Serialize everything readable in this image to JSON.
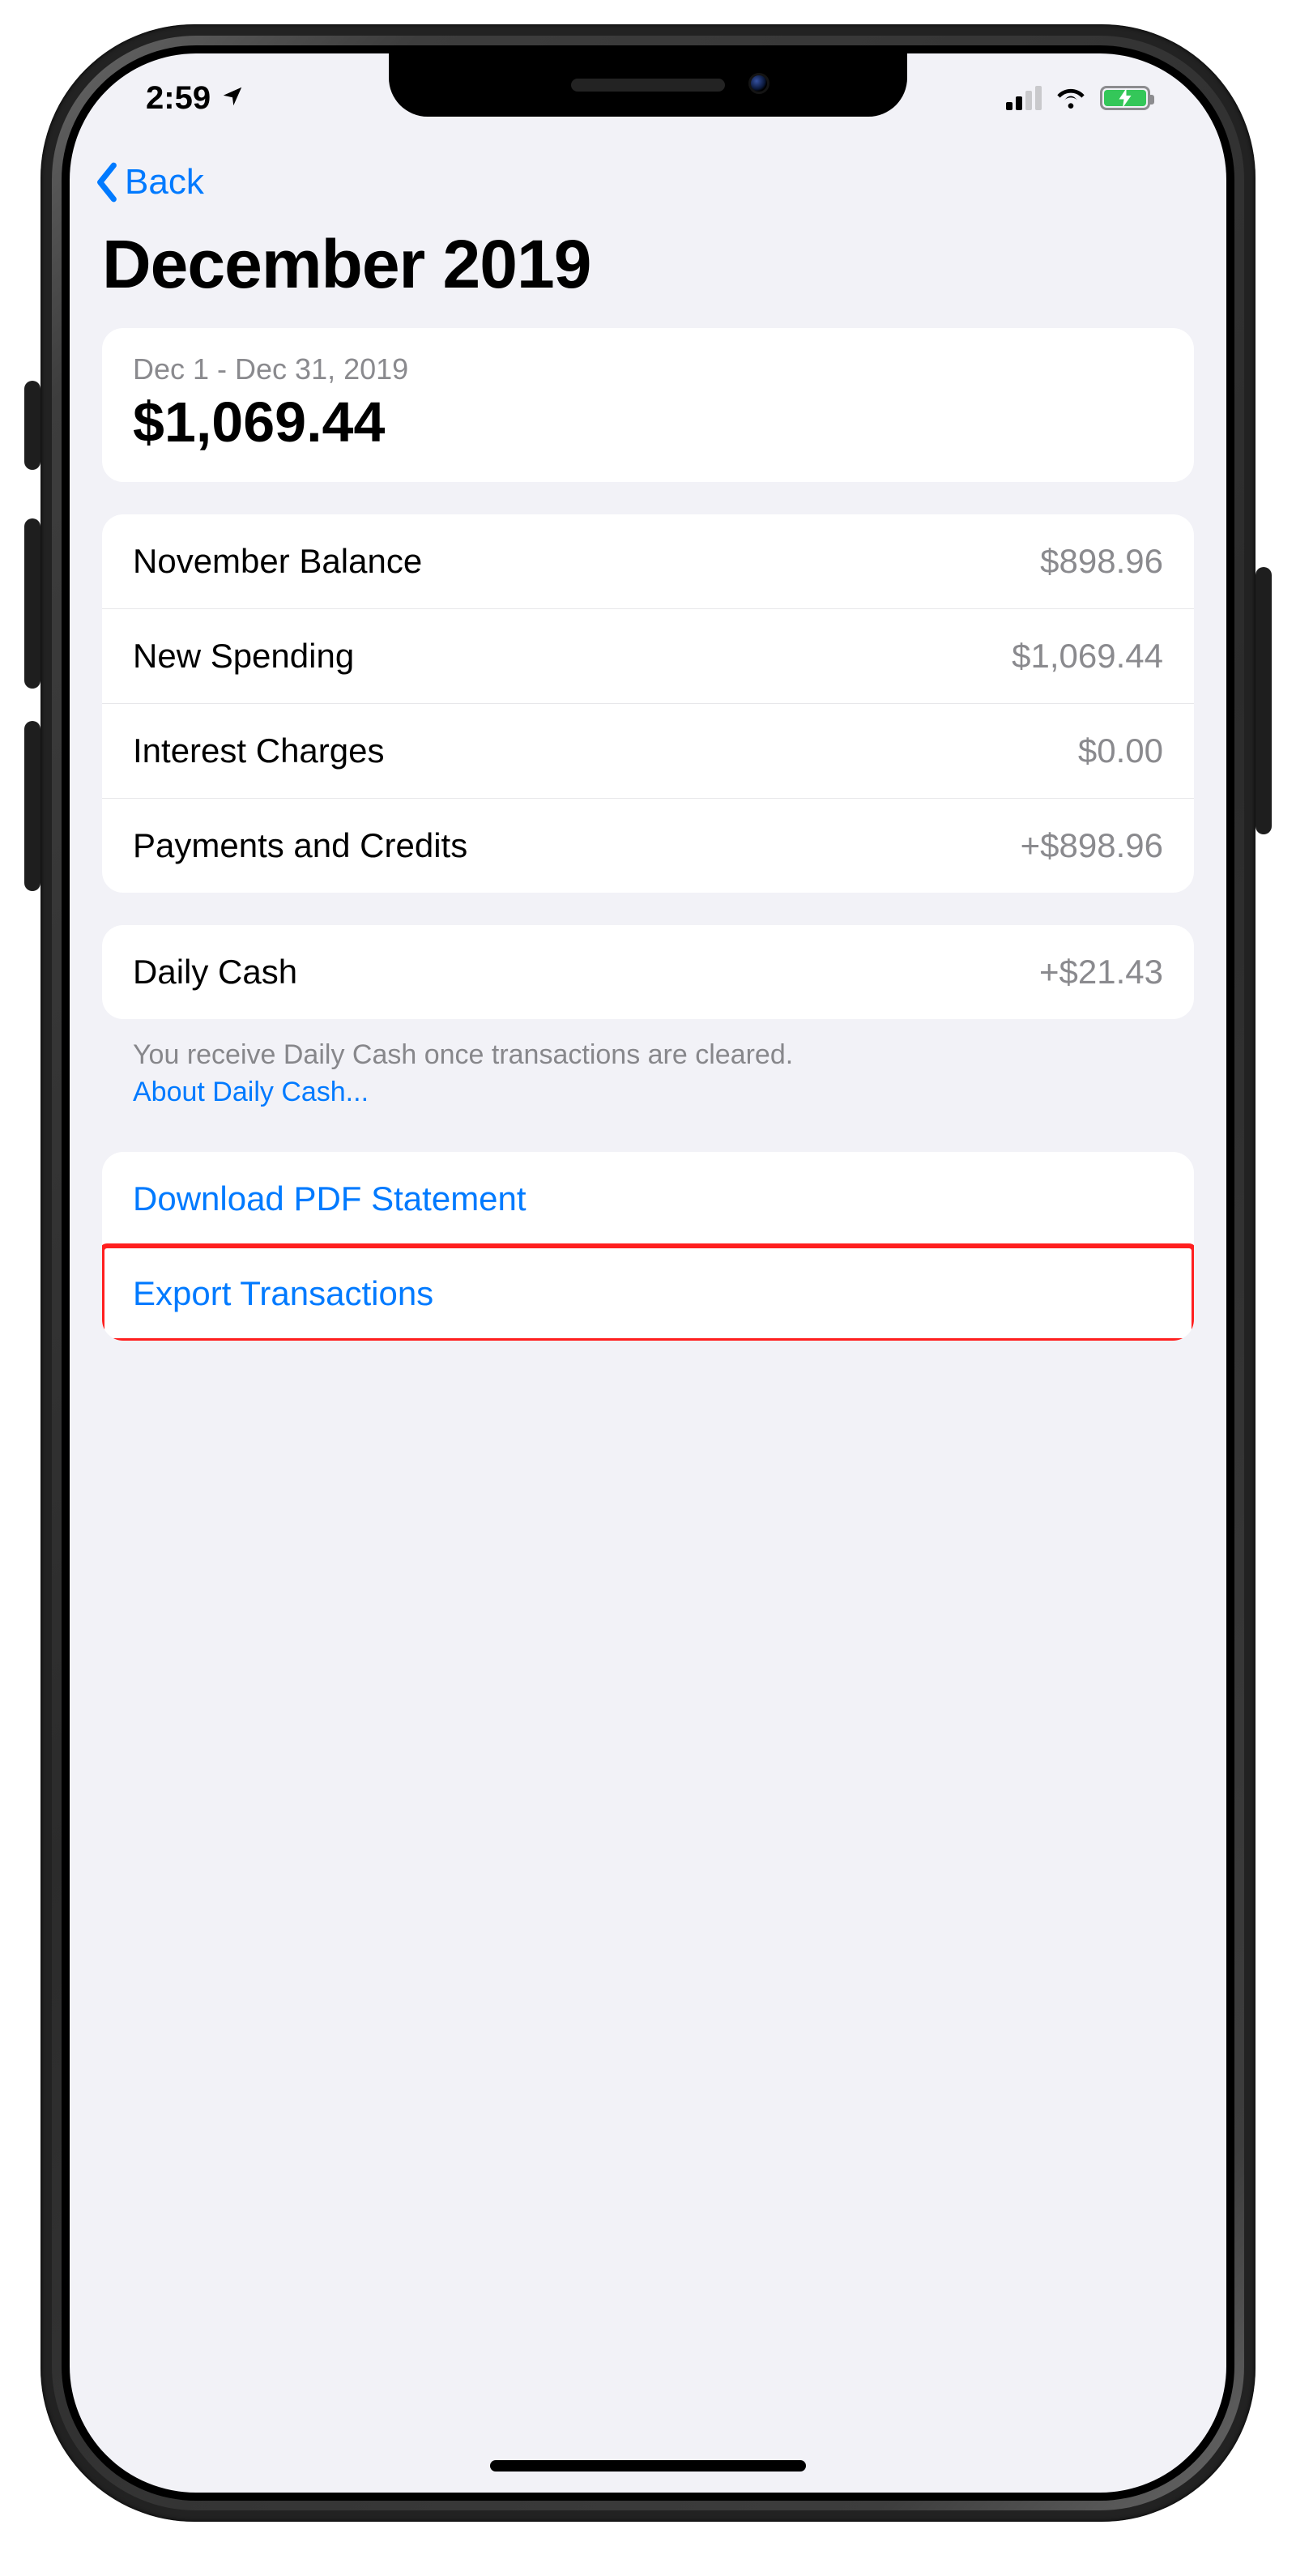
{
  "status": {
    "time": "2:59",
    "location_services": true,
    "signal_bars_active": 2,
    "wifi": true,
    "battery_charging": true
  },
  "nav": {
    "back_label": "Back"
  },
  "title": "December 2019",
  "summary": {
    "range": "Dec 1 - Dec 31, 2019",
    "amount": "$1,069.44"
  },
  "rows": {
    "prev_balance_label": "November Balance",
    "prev_balance_value": "$898.96",
    "new_spending_label": "New Spending",
    "new_spending_value": "$1,069.44",
    "interest_label": "Interest Charges",
    "interest_value": "$0.00",
    "payments_label": "Payments and Credits",
    "payments_value": "+$898.96",
    "daily_cash_label": "Daily Cash",
    "daily_cash_value": "+$21.43"
  },
  "daily_cash_note": {
    "text": "You receive Daily Cash once transactions are cleared.",
    "link": "About Daily Cash..."
  },
  "actions": {
    "download_pdf": "Download PDF Statement",
    "export": "Export Transactions"
  }
}
